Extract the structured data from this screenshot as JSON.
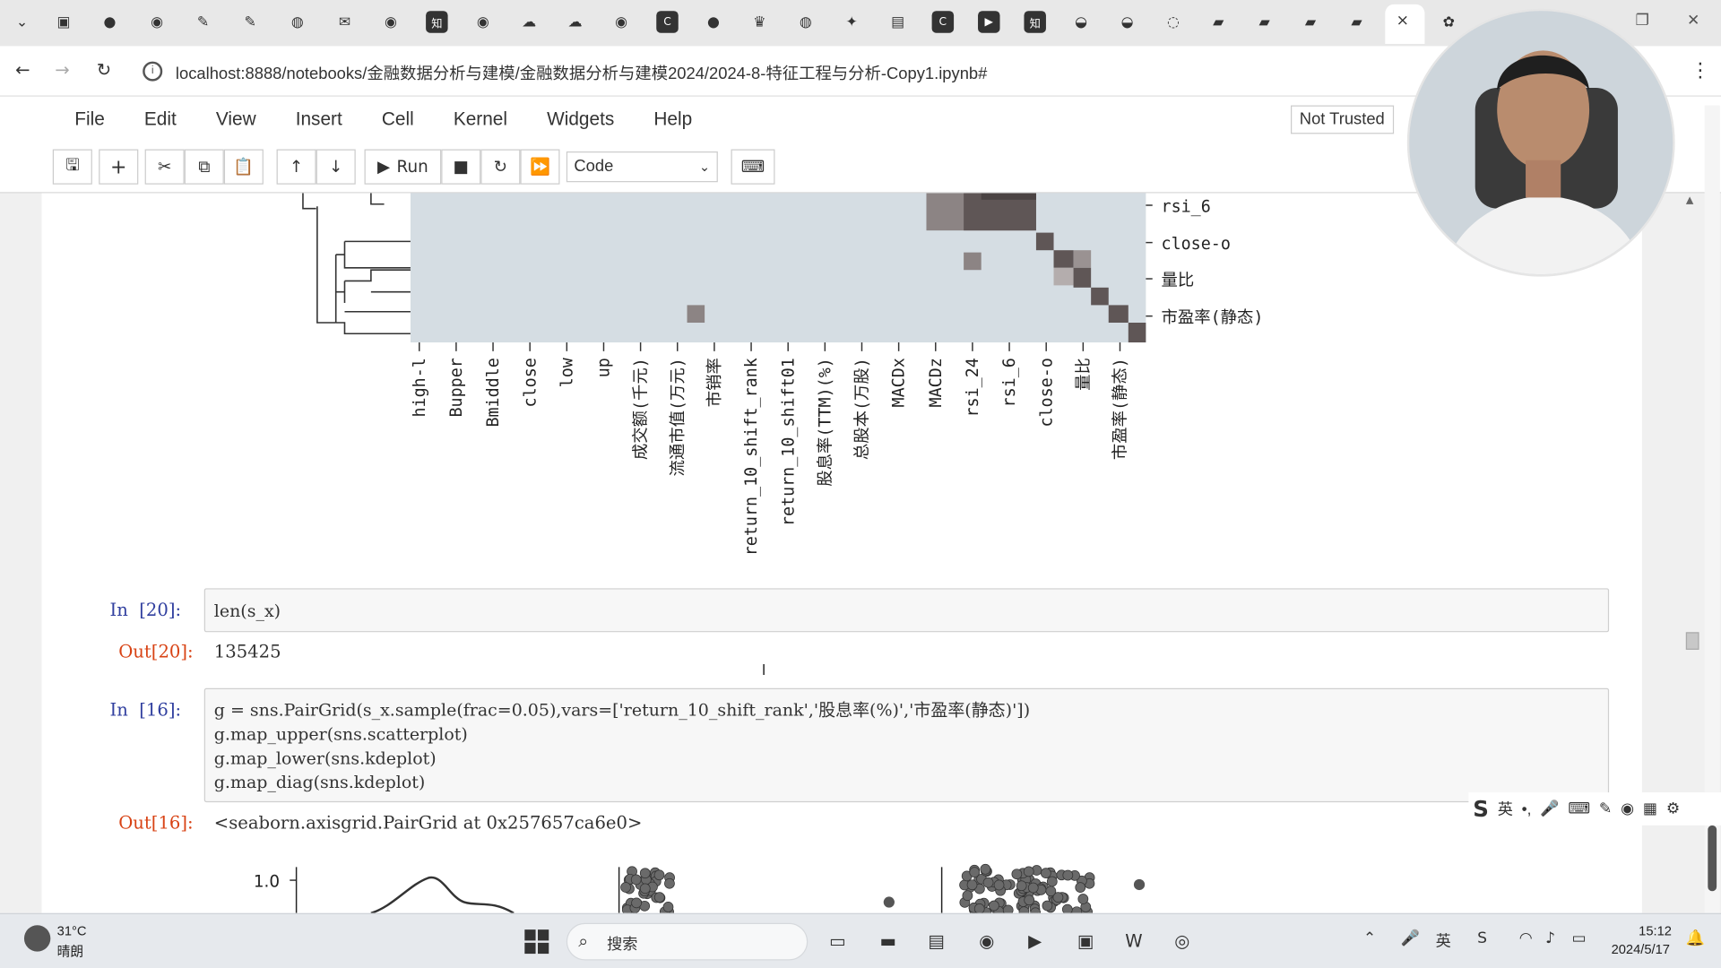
{
  "browser": {
    "tab_icons": [
      "calendar-icon",
      "record-icon",
      "github-icon",
      "translate-icon",
      "translate-icon",
      "globe-icon",
      "mail-icon",
      "github-icon",
      "zhihu-icon",
      "github-icon",
      "cloud-icon",
      "cloud-icon",
      "github-icon",
      "c-icon",
      "chat-icon",
      "crown-icon",
      "globe-icon",
      "app-icon",
      "app-icon",
      "c-icon",
      "video-icon",
      "zhihu-icon",
      "bowl-icon",
      "bowl-icon",
      "loading-icon",
      "doc-icon",
      "doc-icon",
      "doc-icon",
      "doc-icon"
    ],
    "close_tab": "×",
    "url": "localhost:8888/notebooks/金融数据分析与建模/金融数据分析与建模2024/2024-8-特征工程与分析-Copy1.ipynb#",
    "menu_dots": "⋮"
  },
  "jupyter": {
    "menu": [
      "File",
      "Edit",
      "View",
      "Insert",
      "Cell",
      "Kernel",
      "Widgets",
      "Help"
    ],
    "trust_status": "Not Trusted",
    "toolbar": {
      "run_label": "Run",
      "cell_type": "Code"
    }
  },
  "heatmap": {
    "row_labels": [
      "rsi_6",
      "close-o",
      "量比",
      "市盈率(静态)"
    ],
    "col_labels": [
      "high-l",
      "Bupper",
      "Bmiddle",
      "close",
      "low",
      "up",
      "成交额(千元)",
      "流通市值(万元)",
      "市销率",
      "return_10_shift_rank",
      "return_10_shift01",
      "股息率(TTM)(%)",
      "总股本(万股)",
      "MACDx",
      "MACDz",
      "rsi_24",
      "rsi_6",
      "close-o",
      "量比",
      "市盈率(静态)"
    ],
    "colors": {
      "background": "#d5dde3",
      "strong": "#5f5656",
      "medium": "#8c8484",
      "light": "#b4adad"
    }
  },
  "cells": [
    {
      "in_prompt": "In  [20]:",
      "code": "len(s_x)",
      "out_prompt": "Out[20]:",
      "output": "135425"
    },
    {
      "in_prompt": "In  [16]:",
      "code_lines": [
        "g = sns.PairGrid(s_x.sample(frac=0.05),vars=['return_10_shift_rank','股息率(%)','市盈率(静态)'])",
        "g.map_upper(sns.scatterplot)",
        "g.map_lower(sns.kdeplot)",
        "g.map_diag(sns.kdeplot)"
      ],
      "out_prompt": "Out[16]:",
      "output": "<seaborn.axisgrid.PairGrid at 0x257657ca6e0>"
    }
  ],
  "pairgrid": {
    "y_tick_label": "1.0"
  },
  "ime": {
    "lang": "英",
    "punct": "•,"
  },
  "taskbar": {
    "temp": "31°C",
    "weather": "晴朗",
    "search_placeholder": "搜索",
    "time": "15:12",
    "date": "2024/5/17"
  }
}
